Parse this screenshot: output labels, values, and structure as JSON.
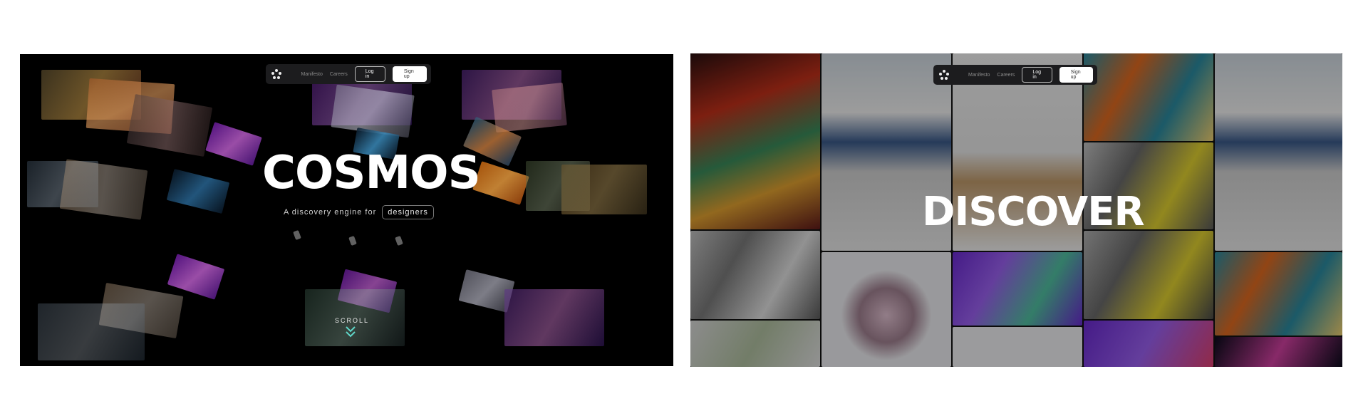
{
  "left": {
    "nav": {
      "links": [
        "Manifesto",
        "Careers"
      ],
      "login": "Log in",
      "signup": "Sign up"
    },
    "title": "COSMOS",
    "subtitle": "A discovery engine for",
    "pill": "designers",
    "scroll": "SCROLL"
  },
  "right": {
    "nav": {
      "links": [
        "Manifesto",
        "Careers"
      ],
      "login": "Log in",
      "signup": "Sign up"
    },
    "title": "DISCOVER"
  },
  "colors": {
    "accent_chevron": "#5fd6c8",
    "signup_bg": "#ffffff",
    "navbar_bg": "#1c1c1e"
  }
}
